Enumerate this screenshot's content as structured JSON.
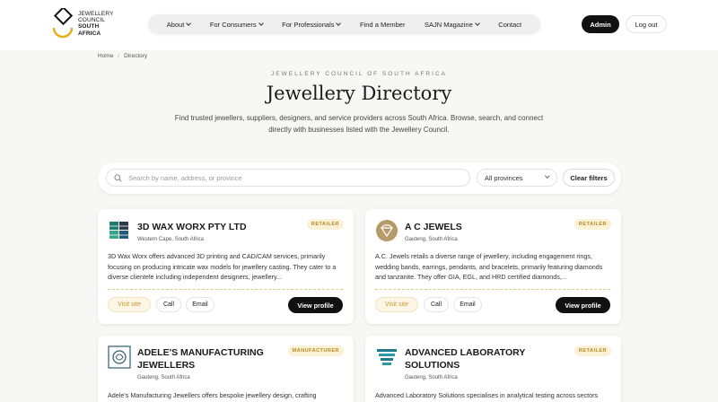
{
  "header": {
    "logo_lines": [
      "JEWELLERY",
      "COUNCIL",
      "SOUTH",
      "AFRICA"
    ],
    "nav": [
      {
        "label": "About",
        "dropdown": true
      },
      {
        "label": "For Consumers",
        "dropdown": true
      },
      {
        "label": "For Professionals",
        "dropdown": true
      },
      {
        "label": "Find a Member",
        "dropdown": false
      },
      {
        "label": "SAJN Magazine",
        "dropdown": true
      },
      {
        "label": "Contact",
        "dropdown": false
      }
    ],
    "admin_label": "Admin",
    "logout_label": "Log out"
  },
  "breadcrumb": {
    "home": "Home",
    "separator": "/",
    "current": "Directory"
  },
  "hero": {
    "eyebrow": "JEWELLERY COUNCIL OF SOUTH AFRICA",
    "title": "Jewellery Directory",
    "subtitle": "Find trusted jewellers, suppliers, designers, and service providers across South Africa. Browse, search, and connect directly with businesses listed with the Jewellery Council."
  },
  "search": {
    "placeholder": "Search by name, address, or province",
    "value": "",
    "province_selected": "All provinces",
    "clear_label": "Clear filters"
  },
  "colors": {
    "accent": "#c59a2b",
    "badge_bg": "#fbf1d7",
    "primary": "#111111"
  },
  "cards": [
    {
      "name": "3D WAX WORX PTY LTD",
      "location": "Western Cape, South Africa",
      "badge": "RETAILER",
      "logo_icon": "wax-cubes-logo",
      "description": "3D Wax Worx offers advanced 3D printing and CAD/CAM services, primarily focusing on producing intricate wax models for jewellery casting. They cater to a diverse clientele including independent designers, jewellery...",
      "visit_label": "Visit site",
      "call_label": "Call",
      "email_label": "Email",
      "profile_label": "View profile"
    },
    {
      "name": "A C JEWELS",
      "location": "Gauteng, South Africa",
      "badge": "RETAILER",
      "logo_icon": "diamond-badge-logo",
      "description": "A.C. Jewels retails a diverse range of jewellery, including engagement rings, wedding bands, earrings, pendants, and bracelets, primarily featuring diamonds and tanzanite. They offer GIA, EGL, and HRD certified diamonds,...",
      "visit_label": "Visit site",
      "call_label": "Call",
      "email_label": "Email",
      "profile_label": "View profile"
    },
    {
      "name": "ADELE'S MANUFACTURING JEWELLERS",
      "location": "Gauteng, South Africa",
      "badge": "MANUFACTURER",
      "logo_icon": "ornate-crest-logo",
      "description": "Adele's Manufacturing Jewellers offers bespoke jewellery design, crafting"
    },
    {
      "name": "ADVANCED LABORATORY SOLUTIONS",
      "location": "Gauteng, South Africa",
      "badge": "RETAILER",
      "logo_icon": "lab-stripes-logo",
      "description": "Advanced Laboratory Solutions specialises in analytical testing across sectors"
    }
  ]
}
